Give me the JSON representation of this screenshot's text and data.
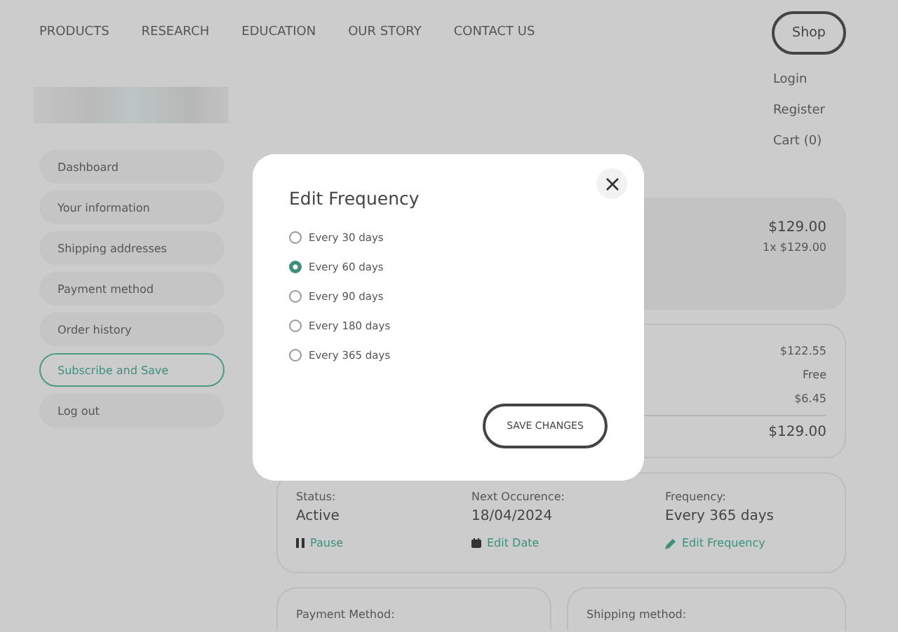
{
  "nav": {
    "links": [
      "PRODUCTS",
      "RESEARCH",
      "EDUCATION",
      "OUR STORY",
      "CONTACT US"
    ],
    "shop_button": "Shop",
    "account_links": [
      "Login",
      "Register",
      "Cart (0)"
    ]
  },
  "sidebar": {
    "items": [
      {
        "label": "Dashboard",
        "selected": false
      },
      {
        "label": "Your information",
        "selected": false
      },
      {
        "label": "Shipping addresses",
        "selected": false
      },
      {
        "label": "Payment method",
        "selected": false
      },
      {
        "label": "Order history",
        "selected": false
      },
      {
        "label": "Subscribe and Save",
        "selected": true
      },
      {
        "label": "Log out",
        "selected": false
      }
    ]
  },
  "product_card": {
    "price": "$129.00",
    "quantity_price": "1x $129.00"
  },
  "summary": {
    "rows": [
      "$122.55",
      "Free",
      "$6.45"
    ],
    "total": "$129.00"
  },
  "subscription": {
    "fields": [
      {
        "label": "Status:",
        "value": "Active",
        "action": "Pause"
      },
      {
        "label": "Next Occurence:",
        "value": "18/04/2024",
        "action": "Edit Date"
      },
      {
        "label": "Frequency:",
        "value": "Every 365 days",
        "action": "Edit Frequency"
      }
    ]
  },
  "payment_card": {
    "label": "Payment Method:"
  },
  "shipping_card": {
    "label": "Shipping method:"
  },
  "modal": {
    "title": "Edit Frequency",
    "options": [
      {
        "label": "Every 30 days",
        "selected": false
      },
      {
        "label": "Every 60 days",
        "selected": true
      },
      {
        "label": "Every 90 days",
        "selected": false
      },
      {
        "label": "Every 180 days",
        "selected": false
      },
      {
        "label": "Every 365 days",
        "selected": false
      }
    ],
    "button": "SAVE CHANGES"
  }
}
